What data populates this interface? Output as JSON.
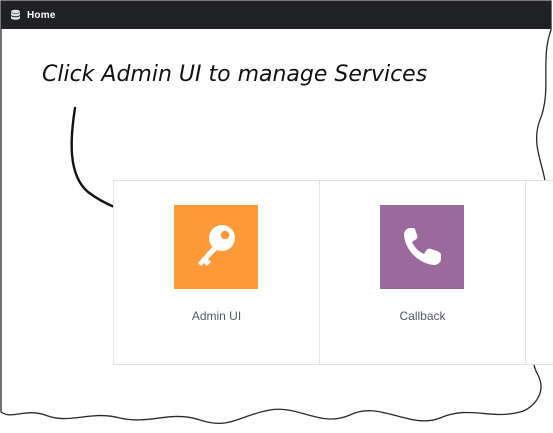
{
  "topbar": {
    "title": "Home",
    "icon": "database-icon",
    "background": "#1f2124"
  },
  "annotation": {
    "text": "Click Admin UI to manage Services"
  },
  "tiles": [
    {
      "label": "Admin UI",
      "icon": "key-icon",
      "color": "#fd9a37"
    },
    {
      "label": "Callback",
      "icon": "phone-icon",
      "color": "#9b6a9d"
    }
  ]
}
